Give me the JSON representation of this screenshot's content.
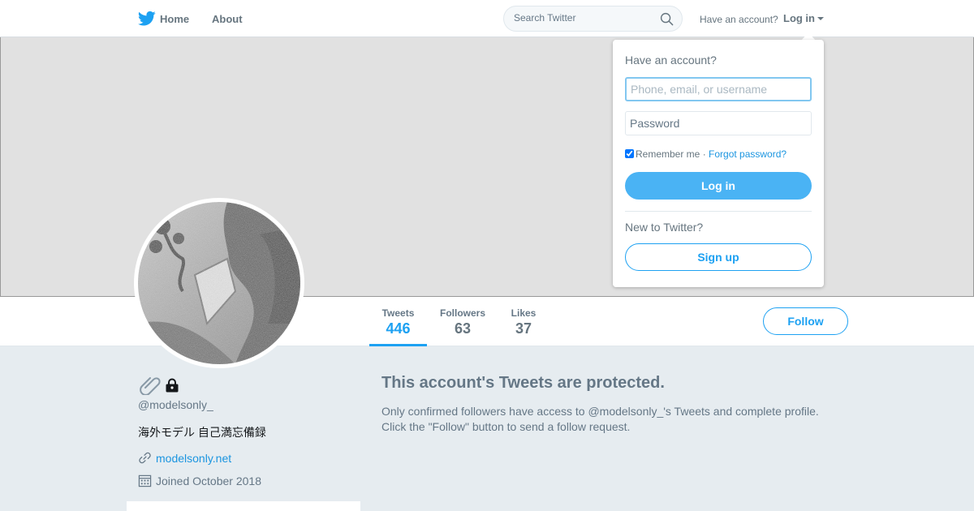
{
  "topbar": {
    "nav": {
      "home": "Home",
      "about": "About"
    },
    "search": {
      "placeholder": "Search Twitter"
    },
    "have_account": "Have an account?",
    "login": "Log in"
  },
  "profile": {
    "stats": {
      "tweets": {
        "label": "Tweets",
        "value": "446"
      },
      "followers": {
        "label": "Followers",
        "value": "63"
      },
      "likes": {
        "label": "Likes",
        "value": "37"
      }
    },
    "follow_button": "Follow",
    "handle": "@modelsonly_",
    "bio": "海外モデル 自己満忘備録",
    "url": "modelsonly.net",
    "joined": "Joined October 2018"
  },
  "protected": {
    "title": "This account's Tweets are protected.",
    "body": "Only confirmed followers have access to @modelsonly_'s Tweets and complete profile. Click the \"Follow\" button to send a follow request."
  },
  "login_dropdown": {
    "title": "Have an account?",
    "username_placeholder": "Phone, email, or username",
    "password_placeholder": "Password",
    "remember_me": "Remember me",
    "separator": " · ",
    "forgot_password": "Forgot password?",
    "login_button": "Log in",
    "new_to_twitter": "New to Twitter?",
    "signup_button": "Sign up"
  },
  "colors": {
    "accent": "#1da1f2",
    "link": "#1b95e0",
    "login_button": "#4ab3f4",
    "page_background": "#e6ecf0",
    "banner": "#e1e1e1"
  }
}
